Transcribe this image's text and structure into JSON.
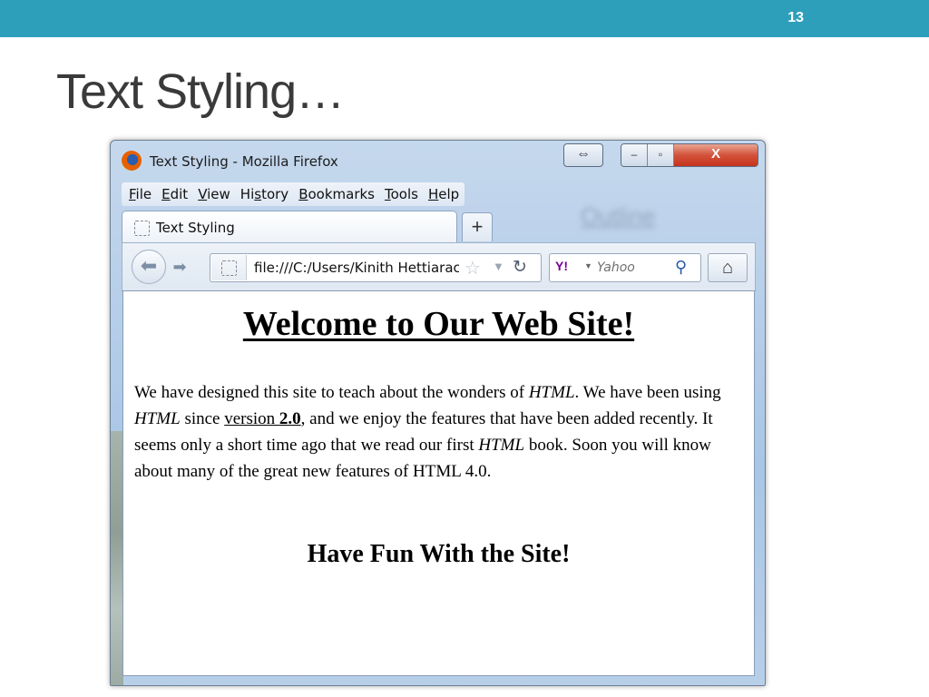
{
  "slide": {
    "number": "13",
    "title": "Text Styling…"
  },
  "browser": {
    "window_title": "Text Styling - Mozilla Firefox",
    "controls": {
      "resize_glyph": "⇔",
      "minimize_glyph": "–",
      "maximize_glyph": "▫",
      "close_glyph": "X"
    },
    "menu": [
      {
        "accel": "F",
        "rest": "ile"
      },
      {
        "accel": "E",
        "rest": "dit"
      },
      {
        "accel": "V",
        "rest": "iew"
      },
      {
        "pre": "Hi",
        "accel": "s",
        "rest": "tory"
      },
      {
        "accel": "B",
        "rest": "ookmarks"
      },
      {
        "accel": "T",
        "rest": "ools"
      },
      {
        "accel": "H",
        "rest": "elp"
      }
    ],
    "background_blur_text": "Outline",
    "tab": {
      "label": "Text Styling",
      "new_tab_glyph": "+"
    },
    "urlbar": {
      "url": "file:///C:/Users/Kinith Hettiarachchi"
    },
    "searchbar": {
      "engine_label": "Y!",
      "placeholder": "Yahoo"
    }
  },
  "page": {
    "heading": "Welcome to Our Web Site!",
    "paragraph": {
      "p1": "We have designed this site to teach about the wonders of ",
      "em1": "HTML",
      "p2": ". We have been using ",
      "em2": "HTML",
      "p3": " since ",
      "link_text": "version ",
      "link_bold": "2.0",
      "p4": ", and we enjoy the features that have been added recently. It seems only a short time ago that we read our first ",
      "em3": "HTML",
      "p5": " book. Soon you will know about many of the great new features of HTML 4.0."
    },
    "subheading": "Have Fun With the Site!"
  },
  "colors": {
    "slide_topbar": "#2e9fba",
    "slide_title": "#3a3a3a",
    "close_button": "#c7331b"
  }
}
